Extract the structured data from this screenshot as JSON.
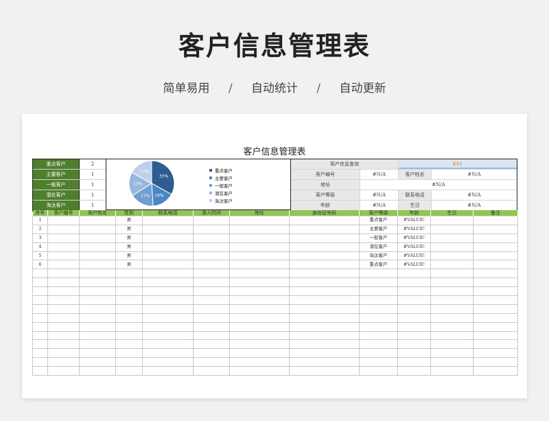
{
  "hero": {
    "title": "客户信息管理表",
    "features": [
      "简单易用",
      "自动统计",
      "自动更新"
    ],
    "separator": "/"
  },
  "sheet": {
    "title": "客户信息管理表"
  },
  "summary": [
    {
      "label": "重点客户",
      "value": "2"
    },
    {
      "label": "主要客户",
      "value": "1"
    },
    {
      "label": "一般客户",
      "value": "1"
    },
    {
      "label": "潜在客户",
      "value": "1"
    },
    {
      "label": "淘汰客户",
      "value": "1"
    }
  ],
  "chart_data": {
    "type": "pie",
    "categories": [
      "重点客户",
      "主要客户",
      "一般客户",
      "潜在客户",
      "淘汰客户"
    ],
    "values": [
      33,
      16,
      17,
      17,
      17
    ],
    "labels": [
      "33%",
      "16%",
      "17%",
      "17%",
      "17%"
    ],
    "colors": [
      "#2e5d92",
      "#4a86c5",
      "#6f9fd3",
      "#96b8df",
      "#bcd0ea"
    ],
    "legend_position": "right"
  },
  "query": {
    "header_label": "客户信息查询",
    "header_value": "K01",
    "rows": [
      [
        "客户编号",
        "#N/A",
        "客户姓名",
        "#N/A"
      ],
      [
        "地址",
        "#N/A"
      ],
      [
        "客户等级",
        "#N/A",
        "联系电话",
        "#N/A"
      ],
      [
        "年龄",
        "#N/A",
        "生日",
        "#N/A"
      ]
    ]
  },
  "table": {
    "headers": [
      "序号",
      "客户编号",
      "客户姓名",
      "性别",
      "联系电话",
      "录入时间",
      "地址",
      "身份证号码",
      "客户等级",
      "年龄",
      "生日",
      "备注"
    ],
    "rows": [
      [
        "1",
        "",
        "",
        "男",
        "",
        "",
        "",
        "",
        "重点客户",
        "#VALUE!",
        "",
        ""
      ],
      [
        "2",
        "",
        "",
        "男",
        "",
        "",
        "",
        "",
        "主要客户",
        "#VALUE!",
        "",
        ""
      ],
      [
        "3",
        "",
        "",
        "男",
        "",
        "",
        "",
        "",
        "一般客户",
        "#VALUE!",
        "",
        ""
      ],
      [
        "4",
        "",
        "",
        "男",
        "",
        "",
        "",
        "",
        "潜在客户",
        "#VALUE!",
        "",
        ""
      ],
      [
        "5",
        "",
        "",
        "男",
        "",
        "",
        "",
        "",
        "淘汰客户",
        "#VALUE!",
        "",
        ""
      ],
      [
        "6",
        "",
        "",
        "男",
        "",
        "",
        "",
        "",
        "重点客户",
        "#VALUE!",
        "",
        ""
      ]
    ],
    "empty_rows": 12
  }
}
